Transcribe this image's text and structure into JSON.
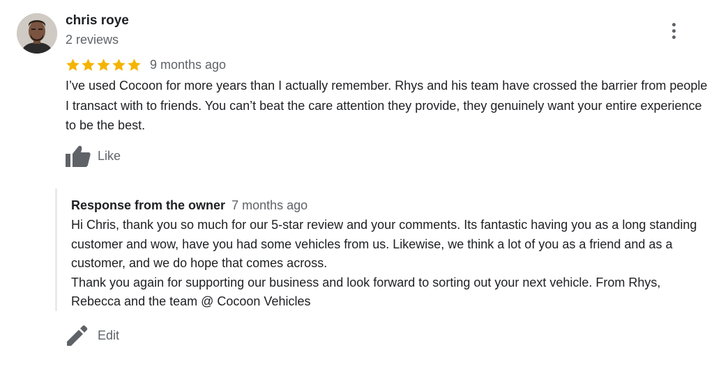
{
  "review": {
    "reviewer": {
      "name": "chris roye",
      "review_count": "2 reviews"
    },
    "rating": 5,
    "max_rating": 5,
    "date": "9 months ago",
    "text": "I’ve used Cocoon for more years than I actually remember. Rhys and his team have crossed the barrier from people I transact with to friends. You can’t beat the care attention they provide, they genuinely want your entire experience to be the best.",
    "like_label": "Like",
    "icons": {
      "more": "more-vert-icon",
      "star": "star-icon",
      "like": "thumb-up-icon",
      "edit": "pencil-icon"
    },
    "colors": {
      "star": "#f4b400",
      "secondary_text": "#5f6368",
      "icon": "#5f6368",
      "response_border": "#e8eaed"
    }
  },
  "owner_response": {
    "title": "Response from the owner",
    "date": "7 months ago",
    "paragraphs": [
      "Hi Chris, thank you so much for our 5-star review and your comments. Its fantastic having you as a long standing customer and wow, have you had some vehicles from us. Likewise, we think a lot of you as a friend and as a customer, and we do hope that comes across.",
      "Thank you again for supporting our business and look forward to sorting out your next vehicle. From Rhys, Rebecca and the team @ Cocoon Vehicles"
    ]
  },
  "actions": {
    "edit_label": "Edit"
  }
}
